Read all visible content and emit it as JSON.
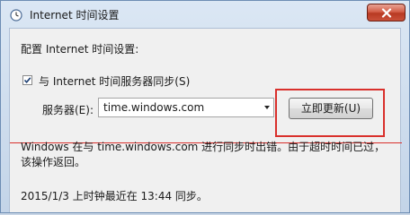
{
  "window": {
    "title": "Internet 时间设置",
    "close_icon": "close-x-icon",
    "accent_close": "#c9503a"
  },
  "content": {
    "config_label": "配置 Internet 时间设置:",
    "sync_checkbox": {
      "label": "与 Internet 时间服务器同步(S)",
      "checked": true
    },
    "server_label": "服务器(E):",
    "server_value": "time.windows.com",
    "update_button": "立即更新(U)",
    "message_line1": "Windows 在与 time.windows.com 进行同步时出错。由于超时时间已过，",
    "message_line2": "该操作返回。",
    "last_sync": "2015/1/3 上时钟最近在 13:44 同步。",
    "highlight_color": "#d9302c"
  }
}
